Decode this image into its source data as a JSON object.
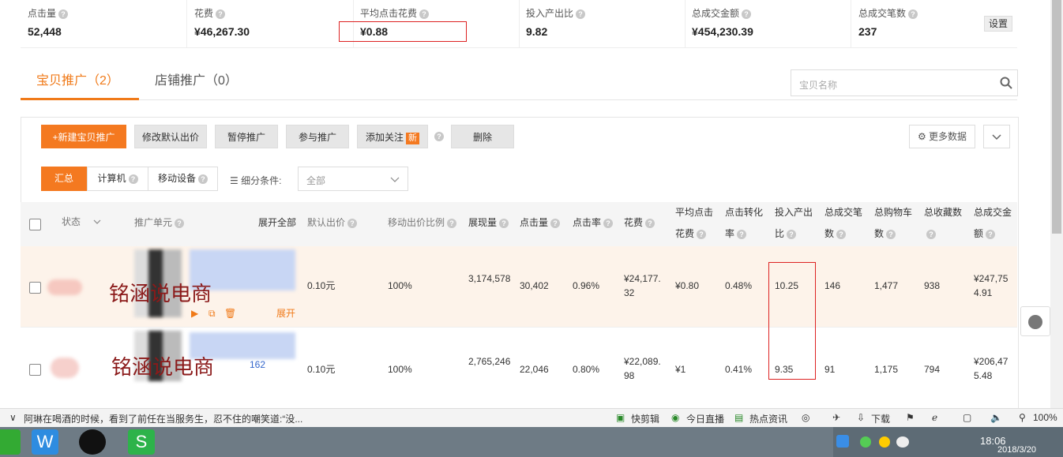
{
  "stats": [
    {
      "label": "点击量",
      "value": "52,448"
    },
    {
      "label": "花费",
      "value": "¥46,267.30"
    },
    {
      "label": "平均点击花费",
      "value": "¥0.88"
    },
    {
      "label": "投入产出比",
      "value": "9.82"
    },
    {
      "label": "总成交金额",
      "value": "¥454,230.39"
    },
    {
      "label": "总成交笔数",
      "value": "237"
    }
  ],
  "settings_label": "设置",
  "tabs": {
    "items": "宝贝推广（2）",
    "shop": "店铺推广（0）"
  },
  "search": {
    "placeholder": "宝贝名称"
  },
  "toolbar": {
    "new": "+新建宝贝推广",
    "edit_bid": "修改默认出价",
    "pause": "暂停推广",
    "join": "参与推广",
    "follow": "添加关注",
    "follow_badge": "新",
    "delete": "删除",
    "more_data": "更多数据"
  },
  "filters": {
    "all": "汇总",
    "pc": "计算机",
    "mobile": "移动设备",
    "cond_label": "细分条件:",
    "cond_value": "全部"
  },
  "table": {
    "headers": {
      "status": "状态",
      "unit": "推广单元",
      "expand_all": "展开全部",
      "bid": "默认出价",
      "mobile_ratio": "移动出价比例",
      "impressions": "展现量",
      "clicks": "点击量",
      "ctr": "点击率",
      "cost": "花费",
      "cpc1": "平均点击",
      "cpc2": "花费",
      "cvr1": "点击转化",
      "cvr2": "率",
      "roi1": "投入产出",
      "roi2": "比",
      "orders1": "总成交笔",
      "orders2": "数",
      "cart1": "总购物车",
      "cart2": "数",
      "fav": "总收藏数",
      "gmv1": "总成交金",
      "gmv2": "额"
    },
    "rows": [
      {
        "bid": "0.10元",
        "mobile_ratio": "100%",
        "impressions": "3,174,578",
        "clicks": "30,402",
        "ctr": "0.96%",
        "cost": "¥24,177.32",
        "cpc": "¥0.80",
        "cvr": "0.48%",
        "roi": "10.25",
        "orders": "146",
        "cart": "1,477",
        "fav": "938",
        "gmv": "¥247,754.91",
        "expand": "展开",
        "watermark": "铭涵说电商"
      },
      {
        "bid": "0.10元",
        "mobile_ratio": "100%",
        "impressions": "2,765,246",
        "clicks": "22,046",
        "ctr": "0.80%",
        "cost": "¥22,089.98",
        "cpc": "¥1",
        "cvr": "0.41%",
        "roi": "9.35",
        "orders": "91",
        "cart": "1,175",
        "fav": "794",
        "gmv": "¥206,475.48",
        "extra": "162",
        "watermark": "铭涵说电商"
      }
    ]
  },
  "statusbar": {
    "news": "阿琳在喝酒的时候，看到了前任在当服务生，忍不住的嘲笑道:“没...",
    "quick_edit": "快剪辑",
    "live": "今日直播",
    "hot": "热点资讯",
    "download": "下载",
    "zoom": "100%"
  },
  "clock": {
    "time": "18:06",
    "date": "2018/3/20"
  }
}
